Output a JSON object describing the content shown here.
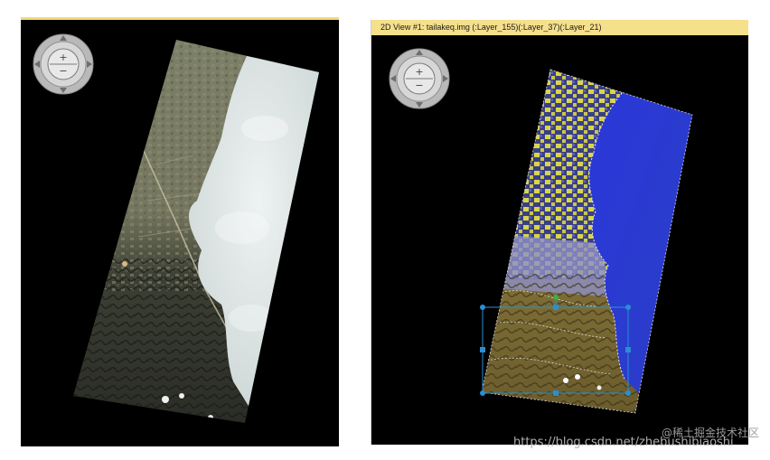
{
  "right_view": {
    "title": "2D View #1: tailakeq.img (:Layer_155)(:Layer_37)(:Layer_21)"
  },
  "navigation": {
    "zoom_in_symbol": "+",
    "zoom_out_symbol": "−"
  },
  "watermark": {
    "site": "@稀土掘金技术社区",
    "url": "https://blog.csdn.net/zhebushibiaoshi"
  },
  "colors": {
    "titlebar": "#f5e08c",
    "viewport_background": "#000000",
    "selection_handle": "#2a8fd0",
    "rotation_handle": "#3cb043",
    "water_false_color": "#2b3ad8",
    "land_true_color": "#6d6a52",
    "land_false_color_highlight": "#d9d64a",
    "cloud": "#dfe6e6"
  },
  "icons": {
    "navigation": "navigation-compass-icon",
    "zoom_in": "zoom-in-icon",
    "zoom_out": "zoom-out-icon",
    "selection": "selection-box-icon"
  }
}
